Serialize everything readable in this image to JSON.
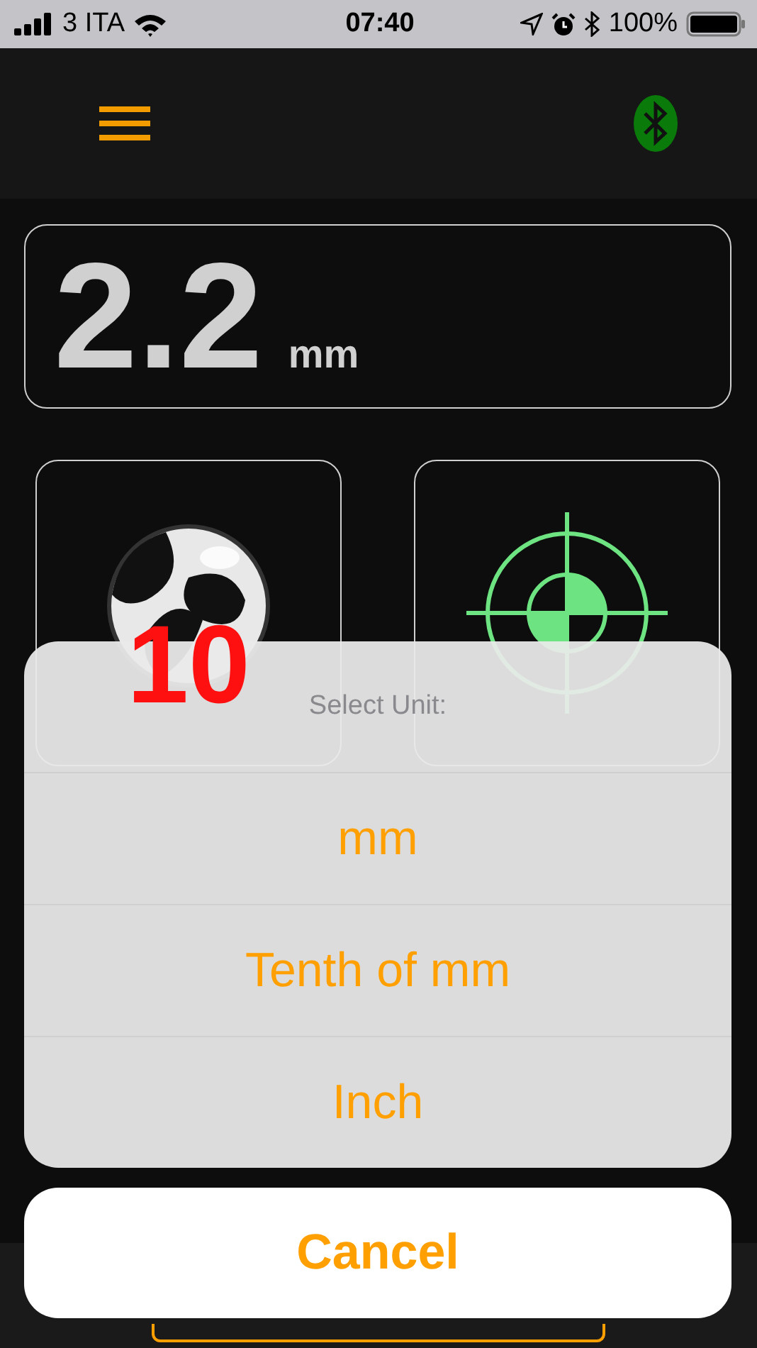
{
  "status_bar": {
    "carrier": "3 ITA",
    "time": "07:40",
    "battery": "100%"
  },
  "reading": {
    "value": "2.2",
    "unit": "mm"
  },
  "tiles": [
    {
      "kind": "ball",
      "label": "10"
    },
    {
      "kind": "target"
    }
  ],
  "action_sheet": {
    "title": "Select Unit:",
    "options": [
      "mm",
      "Tenth of mm",
      "Inch"
    ],
    "cancel": "Cancel"
  }
}
